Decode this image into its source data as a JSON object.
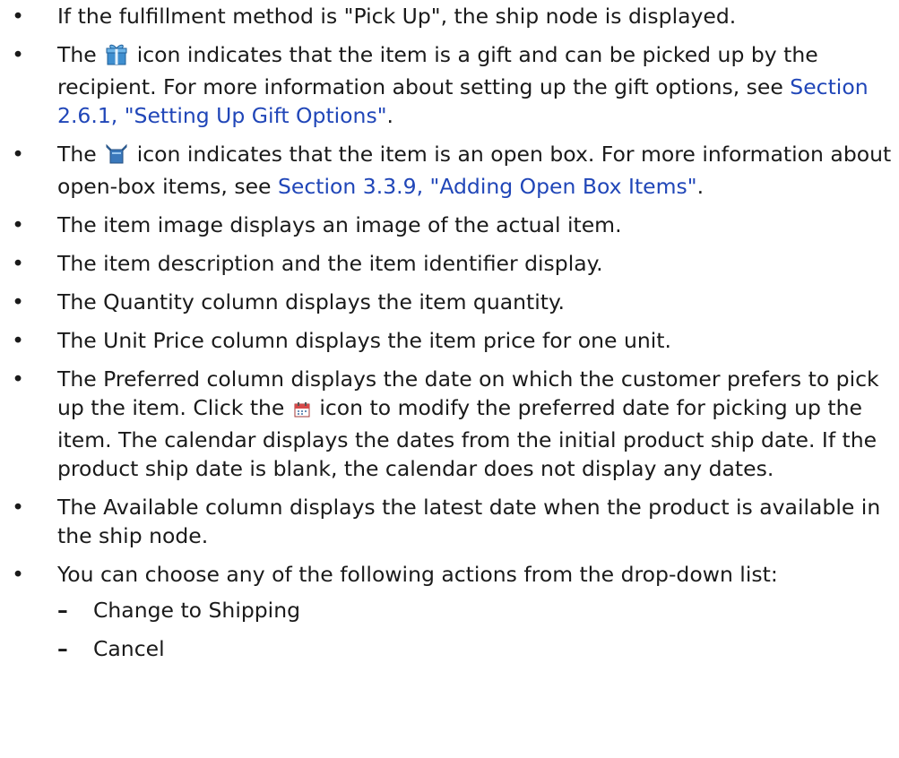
{
  "bullets": [
    {
      "text": "If the fulfillment method is \"Pick Up\", the ship node is displayed."
    },
    {
      "pre": "The",
      "icon": "gift-icon",
      "mid": "icon indicates that the item is a gift and can be picked up by the recipient. For more information about setting up the gift options, see",
      "link": "Section 2.6.1, \"Setting Up Gift Options\"",
      "post": "."
    },
    {
      "pre": "The",
      "icon": "open-box-icon",
      "mid": "icon indicates that the item is an open box. For more information about open-box items, see",
      "link": "Section 3.3.9, \"Adding Open Box Items\"",
      "post": "."
    },
    {
      "text": "The item image displays an image of the actual item."
    },
    {
      "text": "The item description and the item identifier display."
    },
    {
      "text": "The Quantity column displays the item quantity."
    },
    {
      "text": "The Unit Price column displays the item price for one unit."
    },
    {
      "pre": "The Preferred column displays the date on which the customer prefers to pick up the item. Click the",
      "icon": "calendar-icon",
      "post": "icon to modify the preferred date for picking up the item. The calendar displays the dates from the initial product ship date. If the product ship date is blank, the calendar does not display any dates."
    },
    {
      "text": "The Available column displays the latest date when the product is available in the ship node."
    },
    {
      "text": "You can choose any of the following actions from the drop-down list:"
    }
  ],
  "sub_items": [
    "Change to Shipping",
    "Cancel"
  ],
  "bullet_char": "•",
  "dash_char": "–",
  "colors": {
    "link": "#2046b8",
    "text": "#1a1a1a"
  }
}
